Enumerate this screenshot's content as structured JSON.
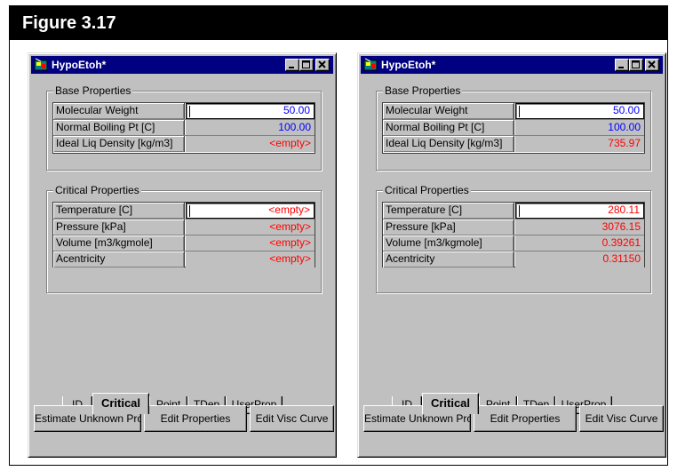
{
  "figure": {
    "title": "Figure 3.17"
  },
  "windows": [
    {
      "title": "HypoEtoh*",
      "base_group": "Base Properties",
      "base_rows": [
        {
          "label": "Molecular Weight",
          "value": "50.00",
          "color": "#0000ff"
        },
        {
          "label": "Normal Boiling Pt [C]",
          "value": "100.00",
          "color": "#0000ff"
        },
        {
          "label": "Ideal Liq Density [kg/m3]",
          "value": "<empty>",
          "color": "#ff0000"
        }
      ],
      "crit_group": "Critical Properties",
      "crit_rows": [
        {
          "label": "Temperature [C]",
          "value": "<empty>",
          "color": "#ff0000"
        },
        {
          "label": "Pressure [kPa]",
          "value": "<empty>",
          "color": "#ff0000"
        },
        {
          "label": "Volume [m3/kgmole]",
          "value": "<empty>",
          "color": "#ff0000"
        },
        {
          "label": "Acentricity",
          "value": "<empty>",
          "color": "#ff0000"
        }
      ],
      "tabs": [
        "ID",
        "Critical",
        "Point",
        "TDep",
        "UserProp"
      ],
      "active_tab": "Critical",
      "buttons": [
        "Estimate Unknown Props",
        "Edit Properties",
        "Edit Visc Curve"
      ]
    },
    {
      "title": "HypoEtoh*",
      "base_group": "Base Properties",
      "base_rows": [
        {
          "label": "Molecular Weight",
          "value": "50.00",
          "color": "#0000ff"
        },
        {
          "label": "Normal Boiling Pt [C]",
          "value": "100.00",
          "color": "#0000ff"
        },
        {
          "label": "Ideal Liq Density [kg/m3]",
          "value": "735.97",
          "color": "#ff0000"
        }
      ],
      "crit_group": "Critical Properties",
      "crit_rows": [
        {
          "label": "Temperature [C]",
          "value": "280.11",
          "color": "#ff0000"
        },
        {
          "label": "Pressure [kPa]",
          "value": "3076.15",
          "color": "#ff0000"
        },
        {
          "label": "Volume [m3/kgmole]",
          "value": "0.39261",
          "color": "#ff0000"
        },
        {
          "label": "Acentricity",
          "value": "0.31150",
          "color": "#ff0000"
        }
      ],
      "tabs": [
        "ID",
        "Critical",
        "Point",
        "TDep",
        "UserProp"
      ],
      "active_tab": "Critical",
      "buttons": [
        "Estimate Unknown Props",
        "Edit Properties",
        "Edit Visc Curve"
      ]
    }
  ],
  "icons": {
    "app": "hypo-component-icon",
    "minimize": "minimize-icon",
    "maximize": "maximize-icon",
    "close": "close-icon"
  },
  "colors": {
    "titlebar": "#000080",
    "specified_value": "#0000ff",
    "calculated_value": "#ff0000",
    "face": "#c0c0c0"
  }
}
